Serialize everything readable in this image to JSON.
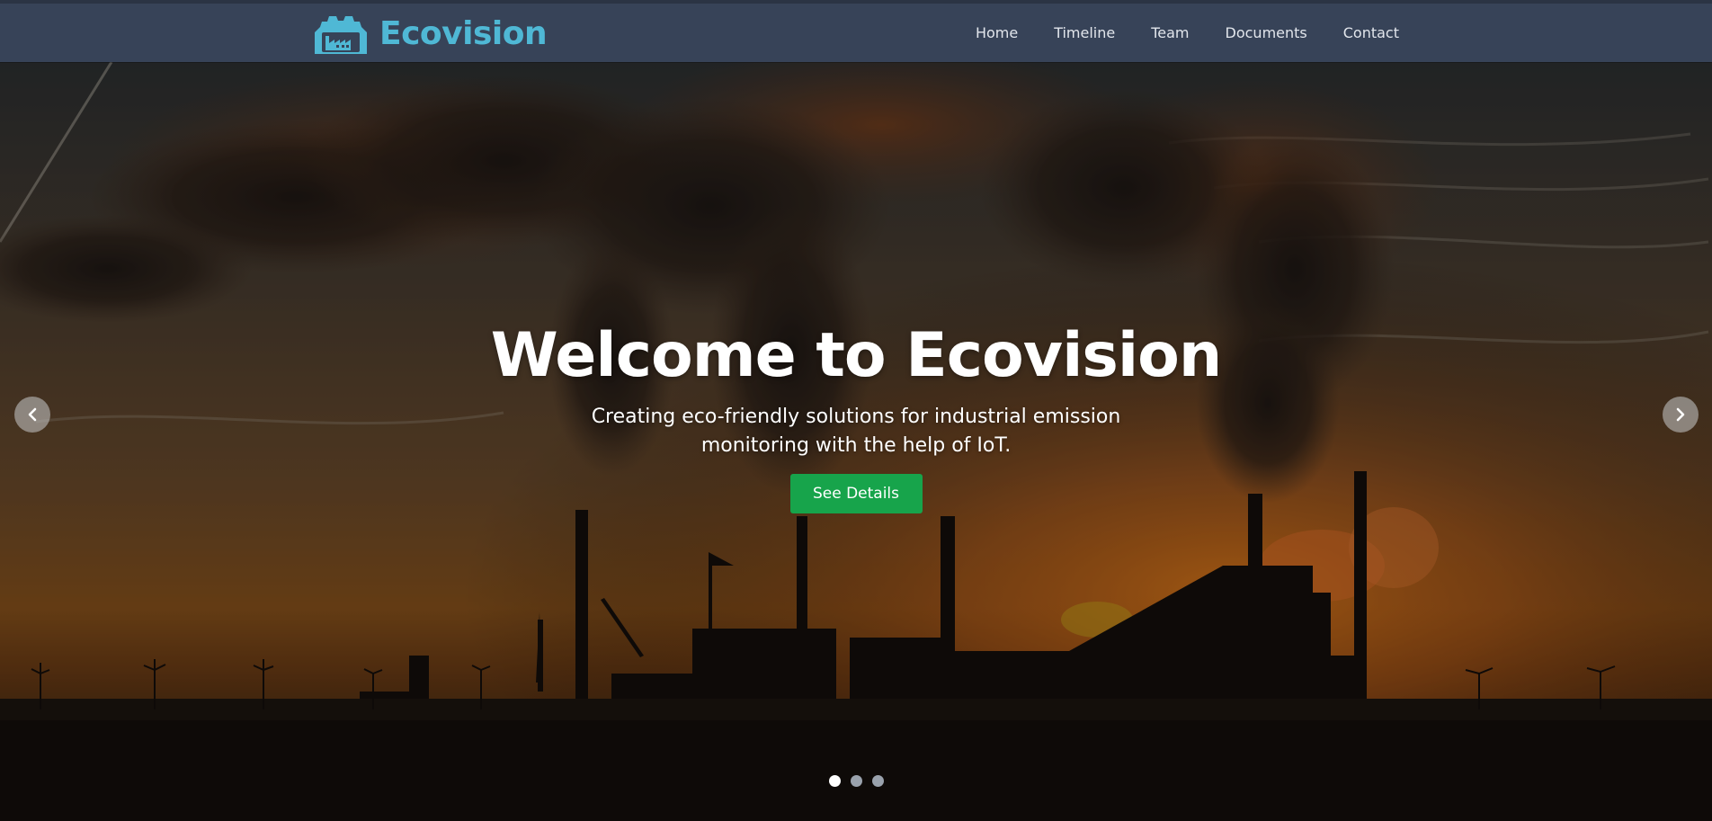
{
  "brand": {
    "name": "Ecovision",
    "logo_icon": "factory-gear-icon",
    "color": "#4fb8d5"
  },
  "nav": {
    "items": [
      {
        "label": "Home"
      },
      {
        "label": "Timeline"
      },
      {
        "label": "Team"
      },
      {
        "label": "Documents"
      },
      {
        "label": "Contact"
      }
    ],
    "background": "#374358"
  },
  "hero": {
    "background_scene": "industrial-smokestacks-sunset",
    "title": "Welcome to Ecovision",
    "subtitle": "Creating eco-friendly solutions for industrial emission monitoring with the help of IoT.",
    "button_label": "See Details",
    "button_color": "#17a44b",
    "prev_icon": "chevron-left-icon",
    "next_icon": "chevron-right-icon",
    "slides_total": 3,
    "active_slide": 1
  }
}
